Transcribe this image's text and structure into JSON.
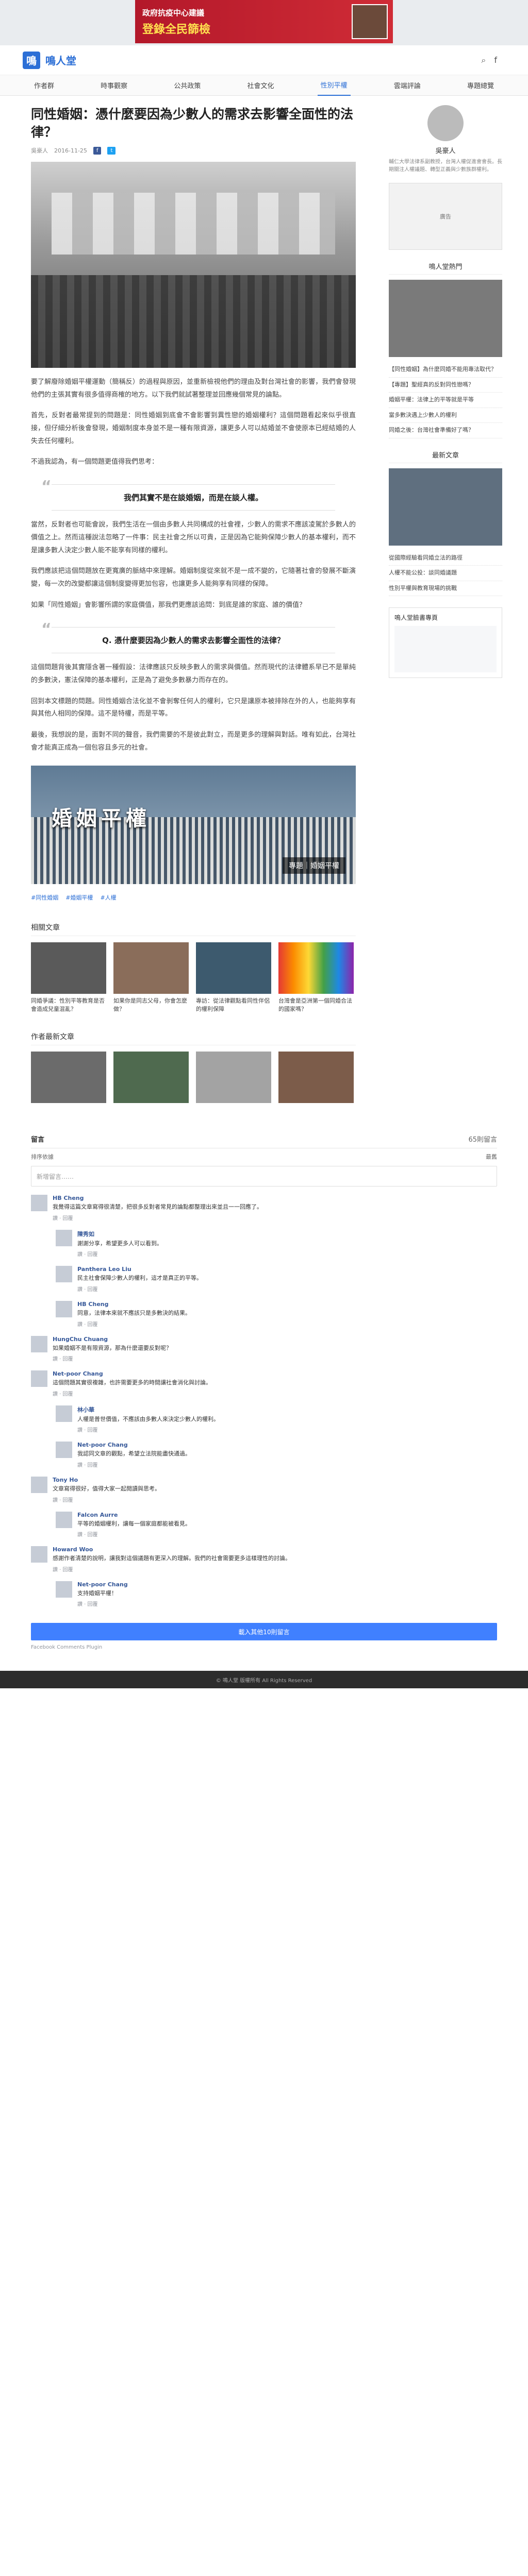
{
  "ad_top": {
    "line1": "政府抗疫中心建議",
    "line2": "登錄全民篩檢"
  },
  "header": {
    "site_name": "鳴人堂",
    "site_name_en": ""
  },
  "nav": [
    {
      "label": "作者群"
    },
    {
      "label": "時事觀察"
    },
    {
      "label": "公共政策"
    },
    {
      "label": "社會文化"
    },
    {
      "label": "性別平權",
      "active": true
    },
    {
      "label": "雲端評論"
    },
    {
      "label": "專題總覽"
    }
  ],
  "article": {
    "title": "同性婚姻：憑什麼要因為少數人的需求去影響全面性的法律？",
    "author": "吳豪人",
    "date": "2016-11-25",
    "hero_caption": "",
    "para1": "要了解廢除婚姻平權運動（簡稱反）的過程與原因，並重新檢視他們的理由及對台灣社會的影響，我們會發現他們的主張其實有很多值得商榷的地方。以下我們就試著整理並回應幾個常見的論點。",
    "para2": "首先，反對者最常提到的問題是：同性婚姻到底會不會影響到異性戀的婚姻權利？這個問題看起來似乎很直接，但仔細分析後會發現，婚姻制度本身並不是一種有限資源，讓更多人可以結婚並不會使原本已經結婚的人失去任何權利。",
    "para3": "不過我認為，有一個問題更值得我們思考：",
    "quote1": "我們其實不是在談婚姻，而是在談人權。",
    "para4": "當然，反對者也可能會說，我們生活在一個由多數人共同構成的社會裡，少數人的需求不應該凌駕於多數人的價值之上。然而這種說法忽略了一件事：民主社會之所以可貴，正是因為它能夠保障少數人的基本權利，而不是讓多數人決定少數人能不能享有同樣的權利。",
    "para5": "我們應該把這個問題放在更寬廣的脈絡中來理解。婚姻制度從來就不是一成不變的，它隨著社會的發展不斷演變，每一次的改變都讓這個制度變得更加包容，也讓更多人能夠享有同樣的保障。",
    "para6": "如果「同性婚姻」會影響所謂的家庭價值，那我們更應該追問：到底是誰的家庭、誰的價值？",
    "quote2": "Q. 憑什麼要因為少數人的需求去影響全面性的法律？",
    "para7": "這個問題背後其實隱含著一種假設：法律應該只反映多數人的需求與價值。然而現代的法律體系早已不是單純的多數決，憲法保障的基本權利，正是為了避免多數暴力而存在的。",
    "para8": "回到本文標題的問題。同性婚姻合法化並不會剝奪任何人的權利，它只是讓原本被排除在外的人，也能夠享有與其他人相同的保障。這不是特權，而是平等。",
    "para9": "最後，我想說的是，面對不同的聲音，我們需要的不是彼此對立，而是更多的理解與對話。唯有如此，台灣社會才能真正成為一個包容且多元的社會。",
    "photo2_sign": "婚姻平權",
    "photo2_tag": "專題｜婚姻平權",
    "photo2_caption": "",
    "tags": [
      "#同性婚姻",
      "#婚姻平權",
      "#人權"
    ]
  },
  "related": {
    "title": "相關文章",
    "items": [
      {
        "text": "同婚爭議：性別平等教育是否會造成兒童混亂？"
      },
      {
        "text": "如果你是同志父母，你會怎麼做？"
      },
      {
        "text": "專訪：從法律觀點看同性伴侶的權利保障"
      },
      {
        "text": "台灣會是亞洲第一個同婚合法的國家嗎？"
      }
    ]
  },
  "author_section": {
    "label": "作者最新文章"
  },
  "sidebar": {
    "author_name": "吳豪人",
    "author_bio": "輔仁大學法律系副教授，台灣人權促進會會長。長期關注人權議題、轉型正義與少數族群權利。",
    "ad_text": "廣告",
    "popular_title": "鳴人堂熱門",
    "popular": [
      "【同性婚姻】為什麼同婚不能用專法取代？",
      "【專題】聖經真的反對同性戀嗎？",
      "婚姻平權：法律上的平等就是平等",
      "當多數決遇上少數人的權利",
      "同婚之後：台灣社會準備好了嗎？"
    ],
    "latest_title": "最新文章",
    "latest": [
      "從國際經驗看同婚立法的路徑",
      "人權不能公投：談同婚議題",
      "性別平權與教育現場的挑戰"
    ],
    "fb_title": "鳴人堂臉書專頁"
  },
  "comments": {
    "head": "留言",
    "count": "65則留言",
    "sort_label": "排序依據",
    "sort_value": "最舊",
    "placeholder": "新增留言……",
    "items": [
      {
        "name": "HB Cheng",
        "text": "我覺得這篇文章寫得很清楚，把很多反對者常見的論點都整理出來並且一一回應了。",
        "reply": false
      },
      {
        "name": "陳秀如",
        "text": "謝謝分享，希望更多人可以看到。",
        "reply": true
      },
      {
        "name": "Panthera Leo Liu",
        "text": "民主社會保障少數人的權利，這才是真正的平等。",
        "reply": true
      },
      {
        "name": "HB Cheng",
        "text": "同意，法律本來就不應該只是多數決的結果。",
        "reply": true
      },
      {
        "name": "HungChu Chuang",
        "text": "如果婚姻不是有限資源，那為什麼還要反對呢？",
        "reply": false
      },
      {
        "name": "Net-poor Chang",
        "text": "這個問題其實很複雜，也許需要更多的時間讓社會消化與討論。",
        "reply": false
      },
      {
        "name": "林小華",
        "text": "人權是普世價值，不應該由多數人來決定少數人的權利。",
        "reply": true
      },
      {
        "name": "Net-poor Chang",
        "text": "我認同文章的觀點，希望立法院能盡快通過。",
        "reply": true
      },
      {
        "name": "Tony Ho",
        "text": "文章寫得很好，值得大家一起閱讀與思考。",
        "reply": false
      },
      {
        "name": "Falcon Aurre",
        "text": "平等的婚姻權利，讓每一個家庭都能被看見。",
        "reply": true
      },
      {
        "name": "Howard Woo",
        "text": "感謝作者清楚的說明，讓我對這個議題有更深入的理解。我們的社會需要更多這樣理性的討論。",
        "reply": false
      },
      {
        "name": "Net-poor Chang",
        "text": "支持婚姻平權！",
        "reply": true
      }
    ],
    "load_more": "載入其他10則留言",
    "plugin": "Facebook Comments Plugin"
  },
  "footer": {
    "text": "© 鳴人堂 版權所有 All Rights Reserved"
  }
}
